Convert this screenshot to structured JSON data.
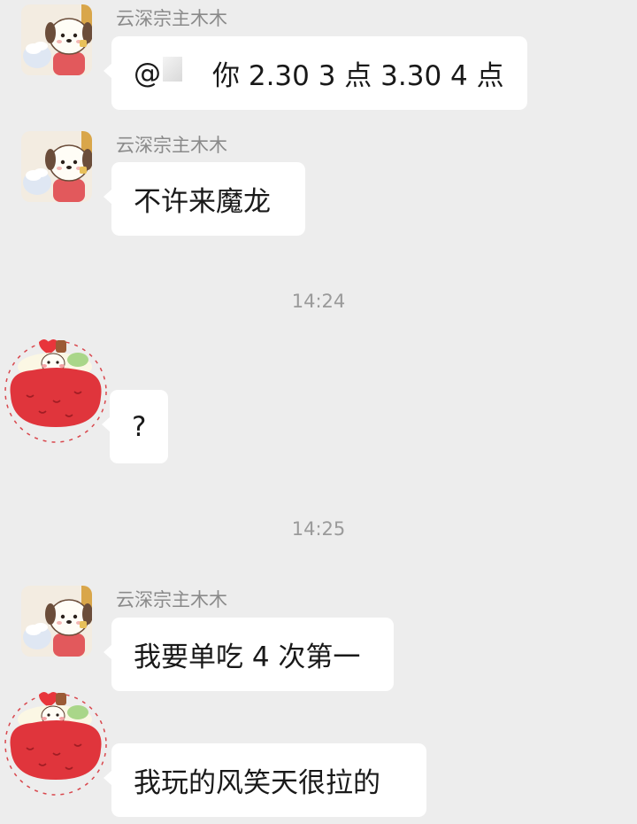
{
  "messages": [
    {
      "sender": "云深宗主木木",
      "text_prefix": "@",
      "text": "你 2.30  3 点  3.30   4 点"
    },
    {
      "sender": "云深宗主木木",
      "text": "不许来魔龙"
    },
    {
      "timestamp": "14:24"
    },
    {
      "text": "?"
    },
    {
      "timestamp": "14:25"
    },
    {
      "sender": "云深宗主木木",
      "text": "我要单吃 4 次第一"
    },
    {
      "text": "我玩的风笑天很拉的"
    }
  ],
  "colors": {
    "background": "#ededed",
    "bubble": "#ffffff",
    "sender_name": "#8a8a8a",
    "timestamp": "#9a9a9a",
    "cherry_avatar": "#e0353c"
  },
  "icons": {
    "dog_avatar": "puppy-sticker-avatar-icon",
    "cherry_avatar": "red-cherry-sticker-avatar-icon"
  }
}
